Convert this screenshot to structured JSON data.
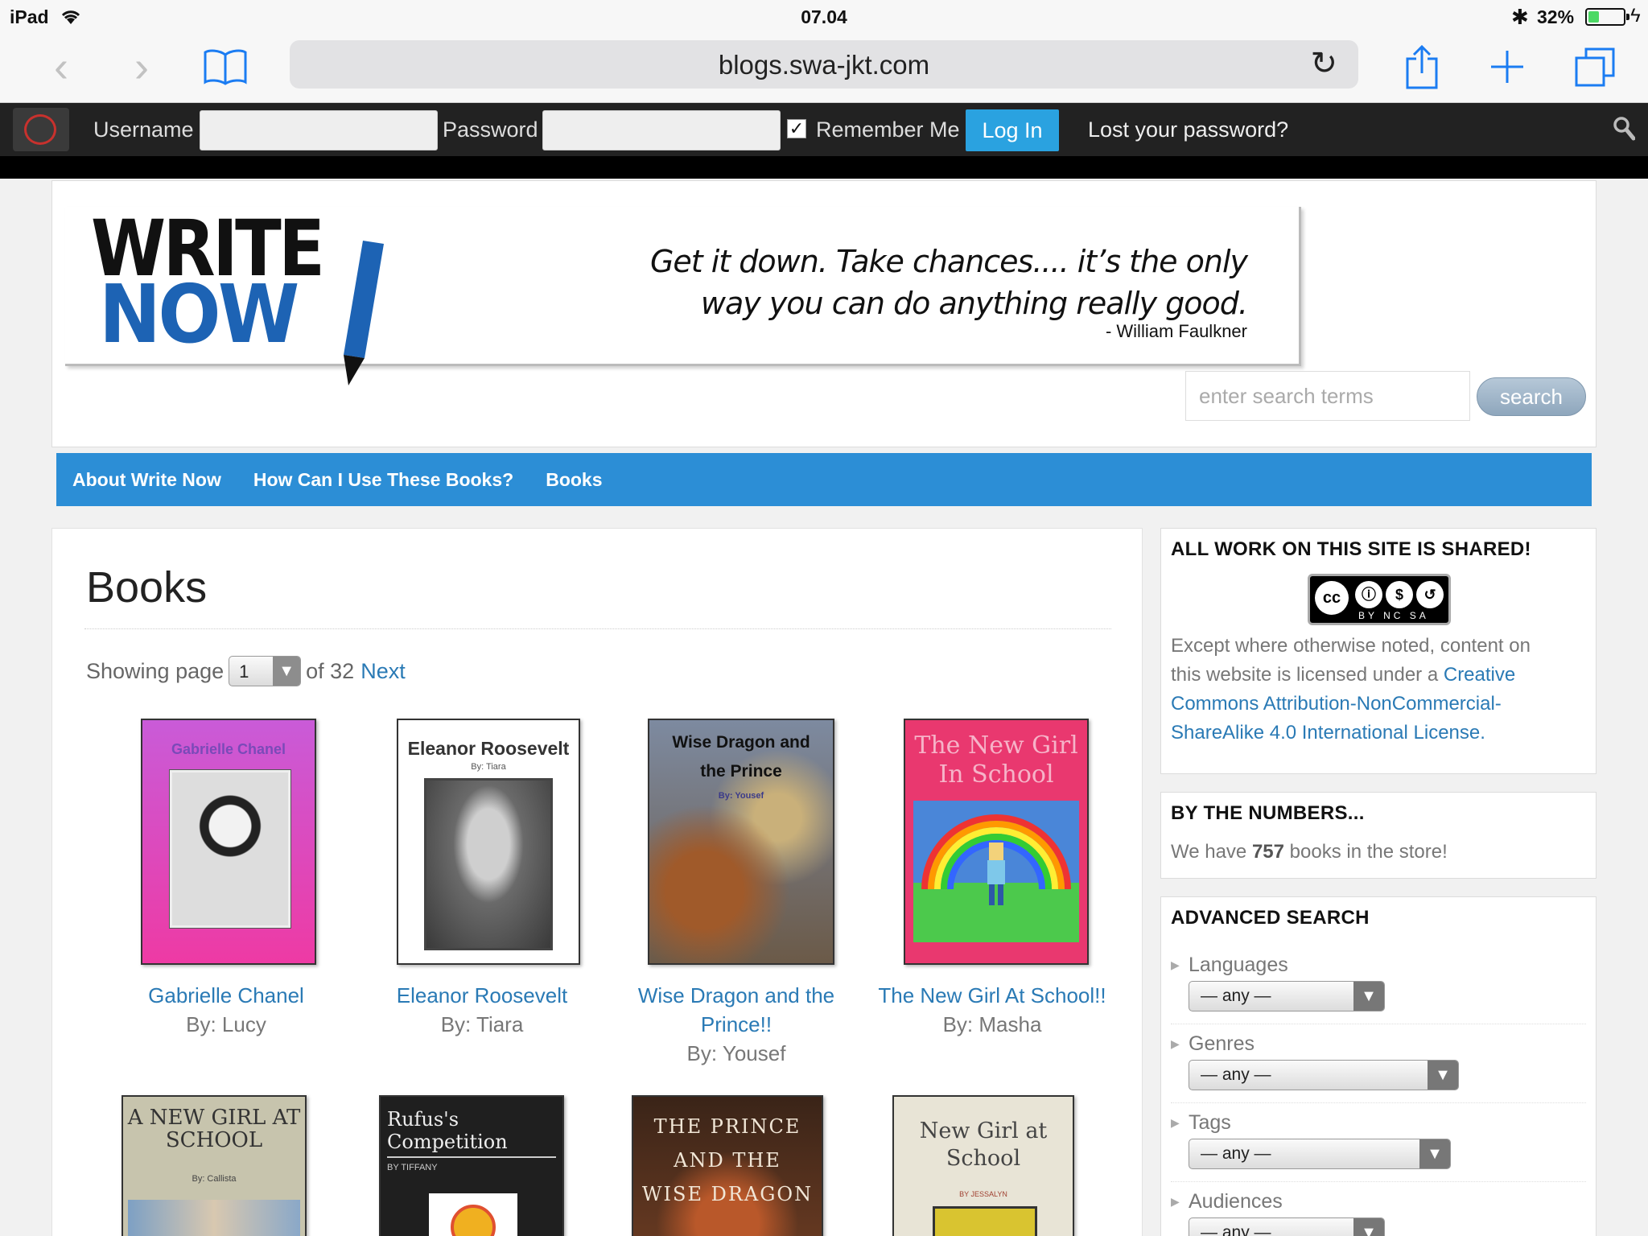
{
  "device": {
    "carrier": "iPad",
    "time": "07.04",
    "battery_pct": "32%",
    "battery_level": 0.32
  },
  "browser": {
    "url": "blogs.swa-jkt.com"
  },
  "admin_bar": {
    "username_label": "Username",
    "password_label": "Password",
    "remember_label": "Remember Me",
    "remember_checked": "✓",
    "login_label": "Log In",
    "lost_password": "Lost your password?"
  },
  "header": {
    "logo_line1": "WRITE",
    "logo_line2": "NOW",
    "quote_line1": "Get it down. Take chances.... it’s the only",
    "quote_line2": "way you can do anything really good.",
    "quote_author": "- William Faulkner",
    "search_placeholder": "enter search terms",
    "search_button": "search"
  },
  "nav": {
    "items": [
      "About Write Now",
      "How Can I Use These Books?",
      "Books"
    ]
  },
  "main": {
    "title": "Books",
    "pager": {
      "prefix": "Showing page",
      "current": "1",
      "of_text": "of 32",
      "next": "Next"
    },
    "books": [
      {
        "title": "Gabrielle Chanel",
        "author": "By: Lucy",
        "cover_title": "Gabrielle Chanel",
        "cover_color": "#e93fae"
      },
      {
        "title": "Eleanor Roosevelt",
        "author": "By: Tiara",
        "cover_title": "Eleanor Roosevelt",
        "cover_byline": "By: Tiara",
        "cover_color": "#ffffff"
      },
      {
        "title_line1": "Wise Dragon and the",
        "title_line2": "Prince!!",
        "author": "By: Yousef",
        "cover_title_line1": "Wise Dragon and",
        "cover_title_line2": "the Prince",
        "cover_byline": "By: Yousef",
        "cover_color": "#8c8a86"
      },
      {
        "title": "The New Girl At School!!",
        "author": "By: Masha",
        "cover_title_line1": "The New Girl",
        "cover_title_line2": "In School",
        "cover_color": "#e9386f"
      }
    ],
    "books_row2": [
      {
        "cover_title_line1": "A NEW GIRL AT",
        "cover_title_line2": "SCHOOL",
        "cover_byline": "By: Callista",
        "cover_color": "#c7c4ad"
      },
      {
        "cover_title_line1": "Rufus's",
        "cover_title_line2": "Competition",
        "cover_byline": "BY TIFFANY",
        "cover_color": "#1f1f1f"
      },
      {
        "cover_title_line1": "THE PRINCE",
        "cover_title_line2": "AND THE",
        "cover_title_line3": "WISE DRAGON",
        "cover_color": "#5a3322"
      },
      {
        "cover_title_line1": "New Girl at",
        "cover_title_line2": "School",
        "cover_byline": "BY JESSALYN",
        "cover_color": "#e8e4d6"
      }
    ]
  },
  "sidebar": {
    "shared": {
      "title": "ALL WORK ON THIS SITE IS SHARED!",
      "badge_sub": "BY NC SA",
      "text_line1": "Except where otherwise noted, content on",
      "text_line2_plain": "this website is licensed under a ",
      "text_line2_link": "Creative",
      "text_line3_link": "Commons Attribution-NonCommercial-",
      "text_line4_link": "ShareAlike 4.0 International License."
    },
    "numbers": {
      "title": "BY THE NUMBERS...",
      "text_before": "We have ",
      "count": "757",
      "text_after": " books in the store!"
    },
    "advanced": {
      "title": "ADVANCED SEARCH",
      "facets": [
        {
          "label": "Languages",
          "value": "— any —"
        },
        {
          "label": "Genres",
          "value": "— any —"
        },
        {
          "label": "Tags",
          "value": "— any —"
        },
        {
          "label": "Audiences",
          "value": "— any —"
        }
      ]
    }
  },
  "colors": {
    "nav_blue": "#2c8ed6",
    "link_blue": "#2a7ab5",
    "admin_bar": "#222222",
    "ios_blue": "#1b7cf2"
  }
}
